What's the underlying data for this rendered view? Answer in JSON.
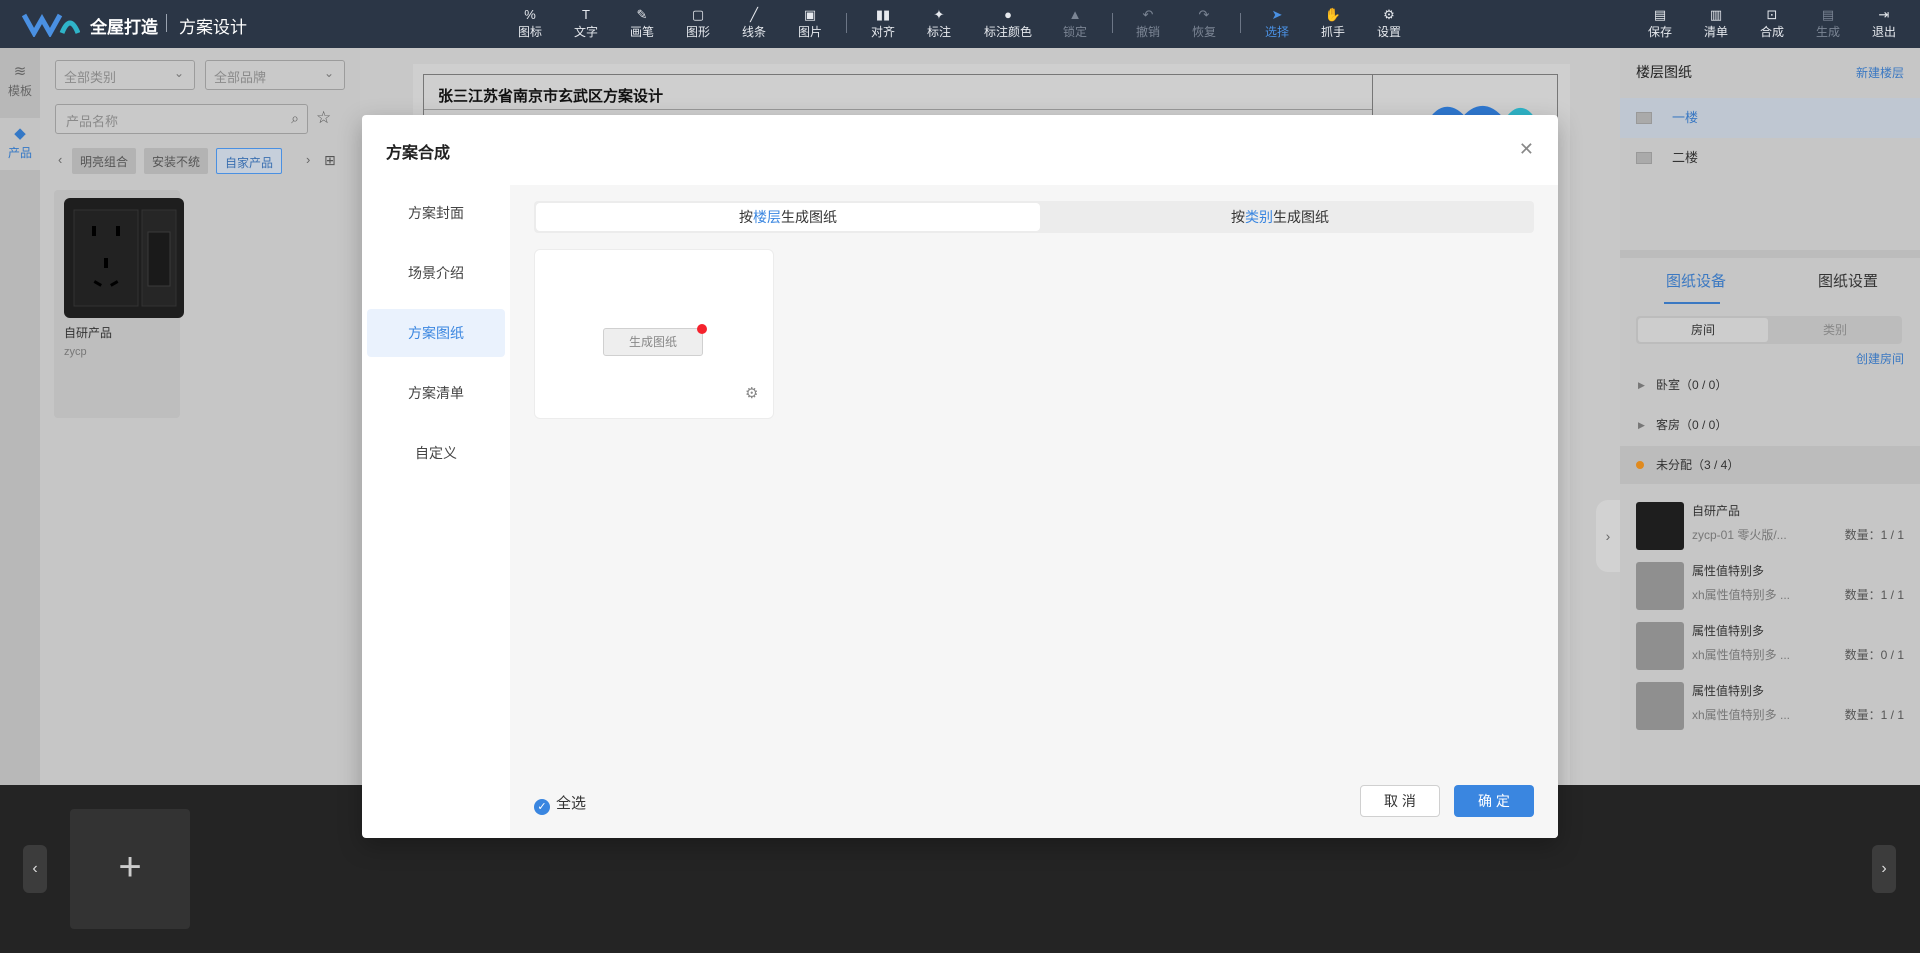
{
  "header": {
    "brand": "全屋打造",
    "subtitle": "方案设计",
    "tools": [
      {
        "label": "图标",
        "icon": "percent-icon"
      },
      {
        "label": "文字",
        "icon": "text-icon"
      },
      {
        "label": "画笔",
        "icon": "brush-icon"
      },
      {
        "label": "图形",
        "icon": "shape-icon"
      },
      {
        "label": "线条",
        "icon": "line-icon"
      },
      {
        "label": "图片",
        "icon": "image-icon"
      },
      {
        "label": "对齐",
        "icon": "align-icon"
      },
      {
        "label": "标注",
        "icon": "pin-icon"
      },
      {
        "label": "标注颜色",
        "icon": "palette-icon"
      },
      {
        "label": "锁定",
        "icon": "lock-icon"
      },
      {
        "label": "撤销",
        "icon": "undo-icon"
      },
      {
        "label": "恢复",
        "icon": "redo-icon"
      },
      {
        "label": "选择",
        "icon": "cursor-icon"
      },
      {
        "label": "抓手",
        "icon": "hand-icon"
      },
      {
        "label": "设置",
        "icon": "gear-icon"
      }
    ],
    "right_tools": [
      {
        "label": "保存",
        "icon": "save-icon"
      },
      {
        "label": "清单",
        "icon": "list-icon"
      },
      {
        "label": "合成",
        "icon": "merge-icon"
      },
      {
        "label": "生成",
        "icon": "generate-icon"
      },
      {
        "label": "退出",
        "icon": "exit-icon"
      }
    ]
  },
  "rail": {
    "items": [
      {
        "label": "模板",
        "icon": "layers-icon"
      },
      {
        "label": "产品",
        "icon": "cube-icon"
      }
    ]
  },
  "product_panel": {
    "category_placeholder": "全部类别",
    "brand_placeholder": "全部品牌",
    "search_placeholder": "产品名称",
    "chips": [
      "明亮组合",
      "安装不统",
      "自家产品"
    ],
    "product": {
      "name": "自研产品",
      "code": "zycp"
    }
  },
  "sheet": {
    "title": "张三江苏省南京市玄武区方案设计"
  },
  "right_panel": {
    "title": "楼层图纸",
    "new_floor": "新建楼层",
    "floors": [
      "一楼",
      "二楼"
    ],
    "tabs": [
      "图纸设备",
      "图纸设置"
    ],
    "segments": [
      "房间",
      "类别"
    ],
    "create_room": "创建房间",
    "groups": [
      {
        "label": "卧室（0 / 0）"
      },
      {
        "label": "客房（0 / 0）"
      },
      {
        "label": "未分配（3 / 4）"
      }
    ],
    "items": [
      {
        "name": "自研产品",
        "sub": "zycp-01 零火版/...",
        "qty": "数量：1 / 1"
      },
      {
        "name": "属性值特别多",
        "sub": "xh属性值特别多 ...",
        "qty": "数量：1 / 1"
      },
      {
        "name": "属性值特别多",
        "sub": "xh属性值特别多 ...",
        "qty": "数量：0 / 1"
      },
      {
        "name": "属性值特别多",
        "sub": "xh属性值特别多 ...",
        "qty": "数量：1 / 1"
      }
    ]
  },
  "modal": {
    "title": "方案合成",
    "nav": [
      "方案封面",
      "场景介绍",
      "方案图纸",
      "方案清单",
      "自定义"
    ],
    "active_nav": "方案图纸",
    "tab1": {
      "pre": "按",
      "hl": "楼层",
      "post": "生成图纸"
    },
    "tab2": {
      "pre": "按",
      "hl": "类别",
      "post": "生成图纸"
    },
    "generate_button": "生成图纸",
    "select_all": "全选",
    "cancel": "取 消",
    "ok": "确 定"
  },
  "colors": {
    "accent": "#3a86e0",
    "topbar": "#2b3646",
    "badge": "#f5222d"
  }
}
